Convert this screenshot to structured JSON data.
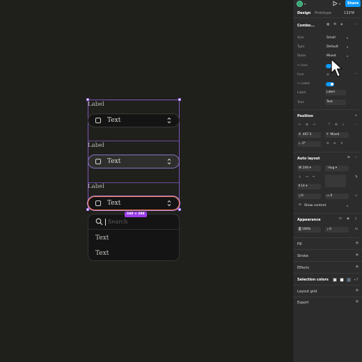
{
  "canvas": {
    "dimension_badge": "240 × 288",
    "comboboxes": [
      {
        "label": "Label",
        "text": "Text",
        "state": "default"
      },
      {
        "label": "Label",
        "text": "Text",
        "state": "hover"
      },
      {
        "label": "Label",
        "text": "Text",
        "state": "focused"
      }
    ],
    "dropdown": {
      "search_placeholder": "Search",
      "items": [
        "Text",
        "Text"
      ]
    }
  },
  "topbar": {
    "share_label": "Share",
    "avatar_icon": "avatar",
    "play_icon": "play-icon"
  },
  "tabs": {
    "design": "Design",
    "prototype": "Prototype",
    "zoom": "132%"
  },
  "component": {
    "name": "Combo...",
    "props": {
      "size_label": "Size",
      "size_value": "Small",
      "type_label": "Type",
      "type_value": "Default",
      "state_label": "State",
      "state_value": "Mixed",
      "icon_toggle_label": "↪ Icon",
      "icon_label": "Icon",
      "label_toggle_label": "↪ Label",
      "label_label": "Label",
      "label_value": "Label",
      "text_label": "Text",
      "text_value": "Text"
    }
  },
  "position": {
    "title": "Position",
    "x_label": "X",
    "x_value": "467.5",
    "y_label": "Y",
    "y_value": "Mixed",
    "rotation_value": "0°"
  },
  "auto_layout": {
    "title": "Auto layout",
    "width_label": "W",
    "width_value": "240",
    "height_value": "Hug",
    "gap_value": "14",
    "padding_h": "0",
    "padding_v": "0",
    "show_content": "Show content"
  },
  "appearance": {
    "title": "Appearance",
    "opacity": "100%",
    "radius": "0"
  },
  "sections": {
    "fill": "Fill",
    "stroke": "Stroke",
    "effects": "Effects",
    "selection_colors": "Selection colors",
    "selection_more": "+7",
    "layout_grid": "Layout grid",
    "export": "Export"
  },
  "colors": {
    "accent": "#0d99ff",
    "selection": "#9b6cf0",
    "focus_ring": "#f07048",
    "swatches": [
      "#d9d9d9",
      "#ffffff",
      "#5a6e8c"
    ]
  }
}
